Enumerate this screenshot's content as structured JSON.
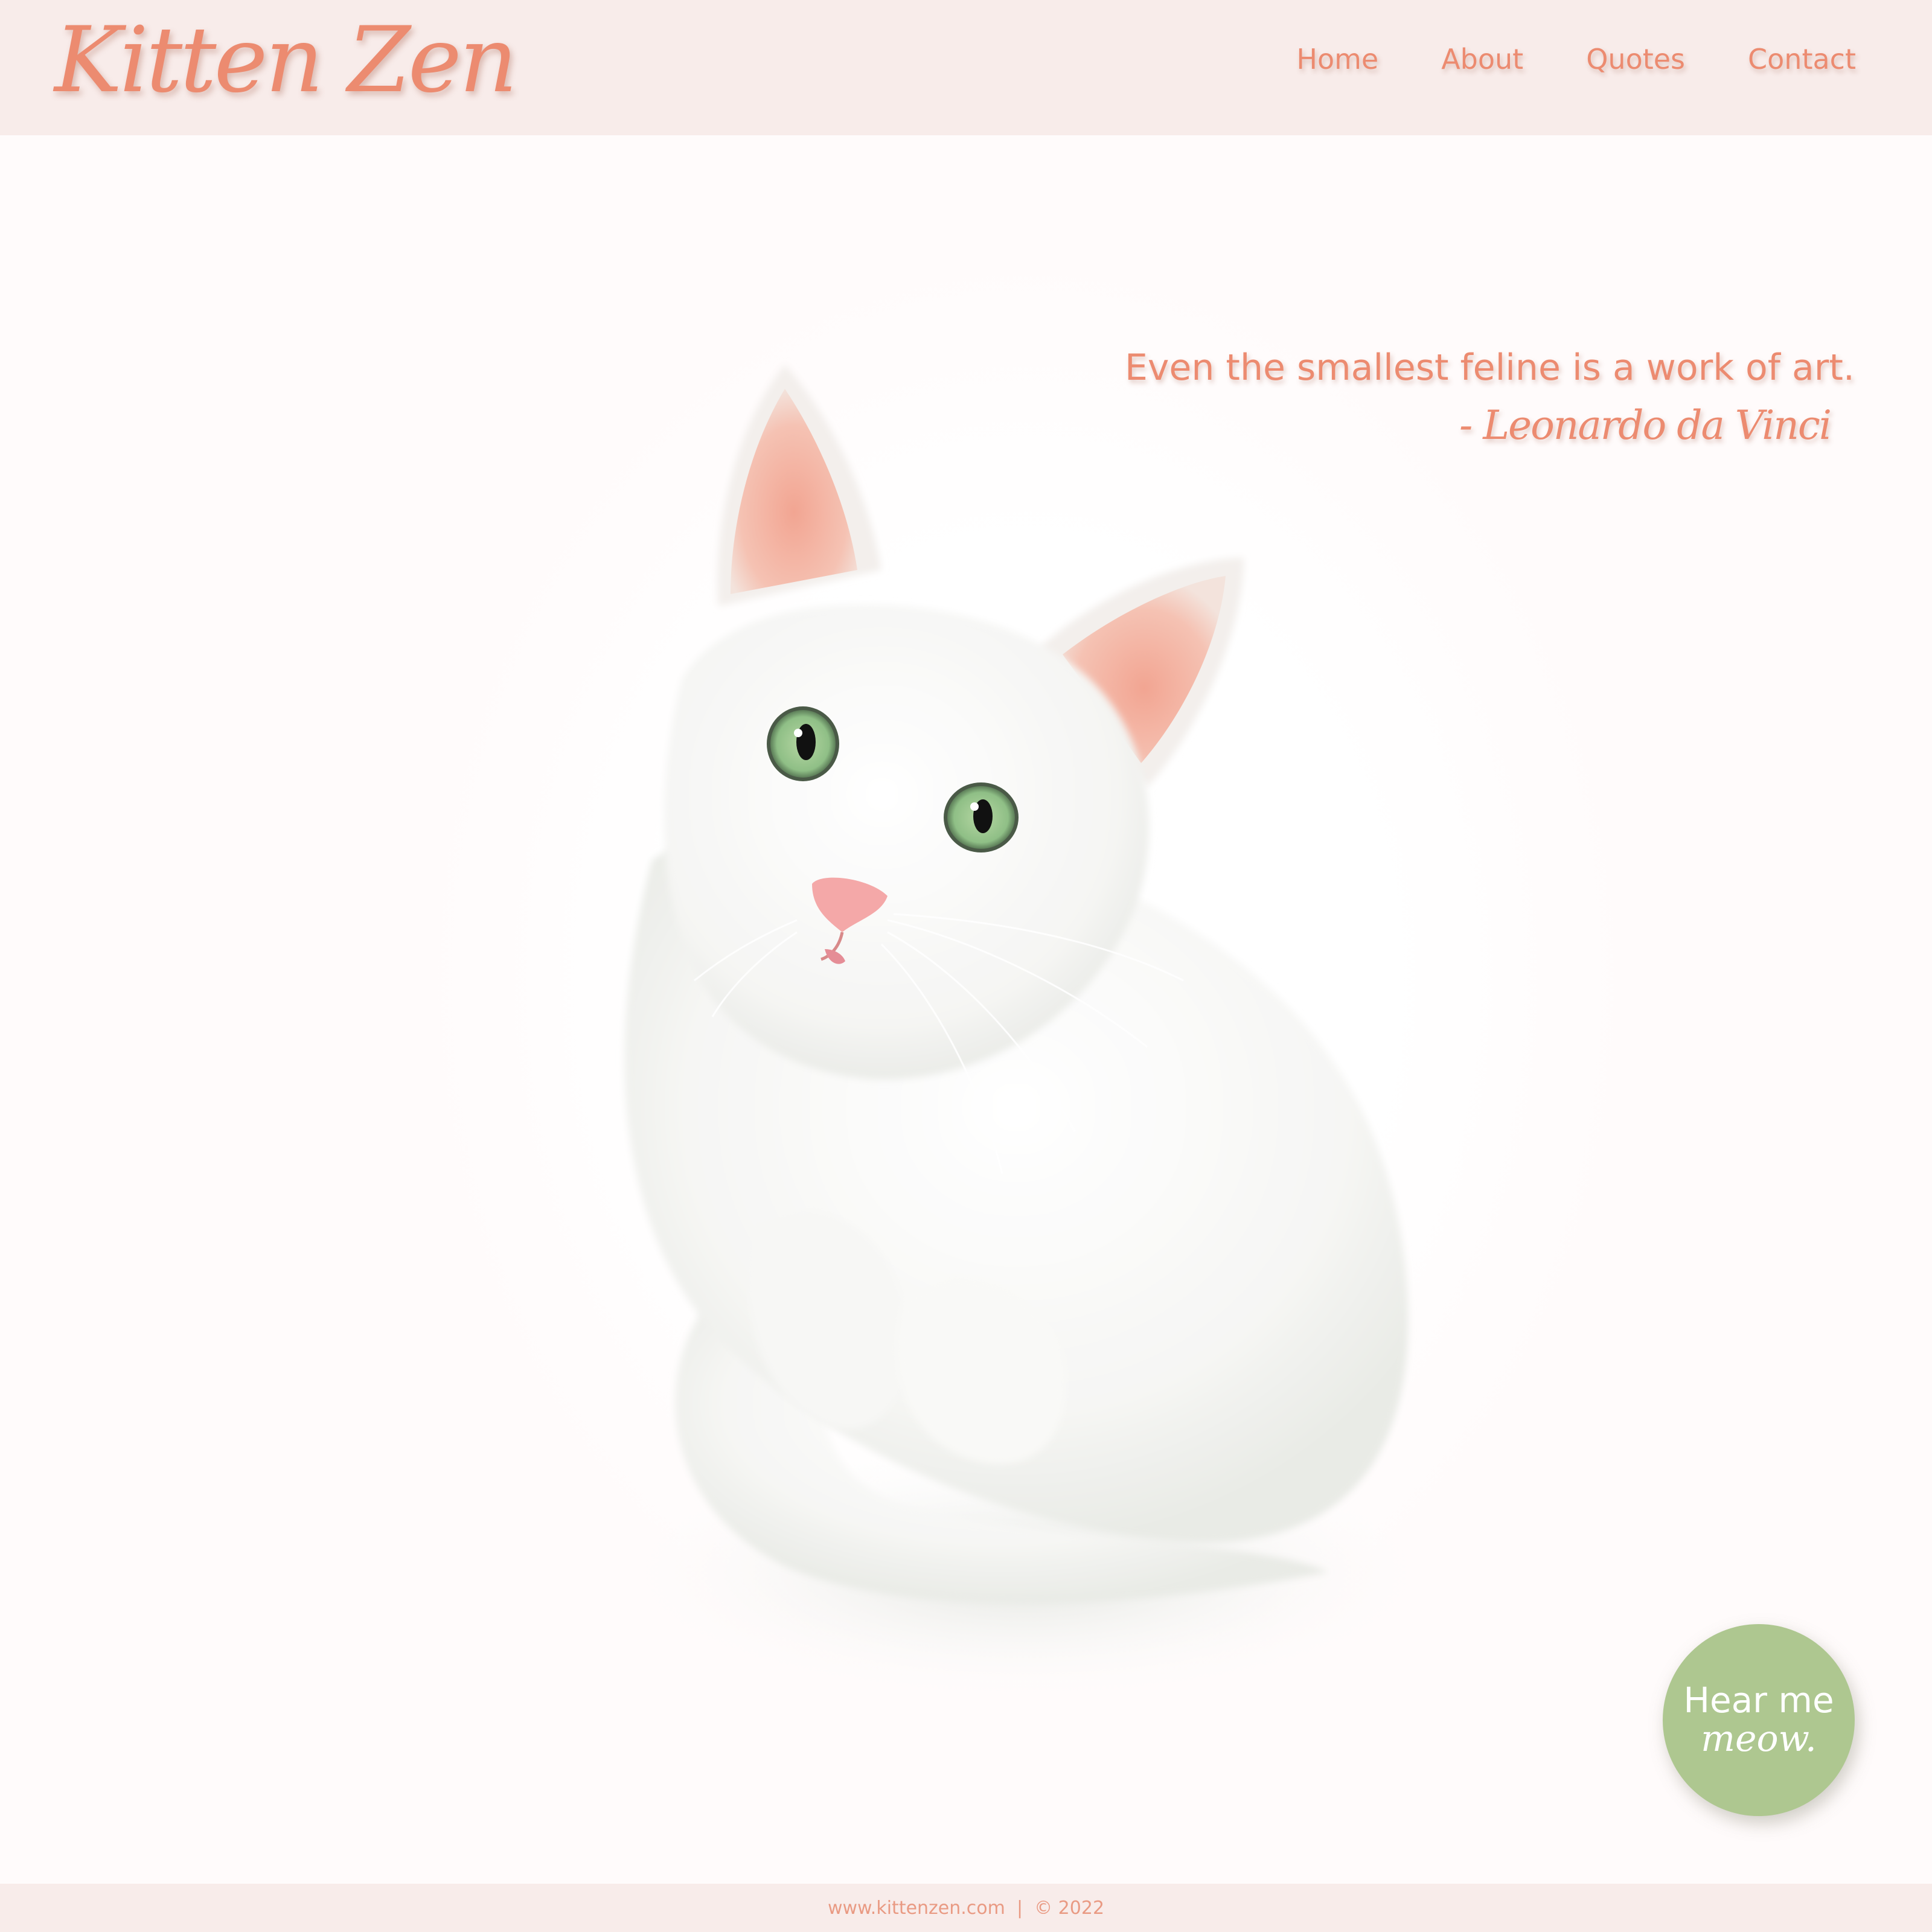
{
  "header": {
    "logo": "Kitten Zen",
    "nav": [
      {
        "label": "Home"
      },
      {
        "label": "About"
      },
      {
        "label": "Quotes"
      },
      {
        "label": "Contact"
      }
    ]
  },
  "hero": {
    "quote": "Even the smallest feline is a work of art.",
    "author": "- Leonardo da Vinci",
    "image_subject": "white kitten with green eyes"
  },
  "cta": {
    "line1": "Hear me",
    "line2": "meow."
  },
  "footer": {
    "url": "www.kittenzen.com",
    "separator": "|",
    "copyright": "© 2022"
  },
  "colors": {
    "brand": "#ec8b70",
    "header_bg": "#f8ecea",
    "cta_bg": "#aec790",
    "eye": "#8fbf86",
    "ear_inner": "#f2a592",
    "nose": "#f4a8a8"
  }
}
